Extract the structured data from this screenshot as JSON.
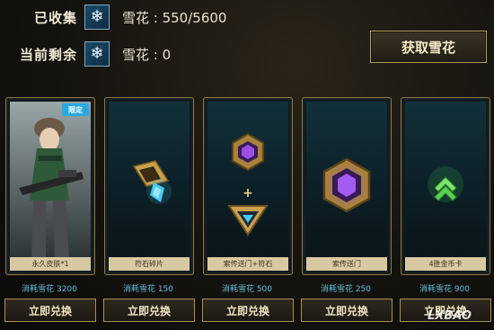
{
  "stats": {
    "collected_label": "已收集",
    "collected_value": "雪花 : 550/5600",
    "remaining_label": "当前剩余",
    "remaining_value": "雪花 : 0",
    "icon": "snowflake-icon"
  },
  "get_button_label": "获取雪花",
  "cards": [
    {
      "tag": "限定",
      "label": "永久皮肤*1",
      "cost": "消耗雪花 3200",
      "button": "立即兑换"
    },
    {
      "label": "符石碎片",
      "cost": "消耗雪花 150",
      "button": "立即兑换"
    },
    {
      "label": "索传送门+符石",
      "cost": "消耗雪花 500",
      "button": "立即兑换",
      "plus": "+"
    },
    {
      "label": "索传送门",
      "cost": "消耗雪花 250",
      "button": "立即兑换"
    },
    {
      "label": "4胜金币卡",
      "cost": "消耗雪花 900",
      "button": "立即兑换"
    }
  ],
  "watermark": "LXBAO",
  "colors": {
    "accent": "#b39a5e",
    "cost": "#5fc0de",
    "label_bg": "#d8c9a2"
  }
}
